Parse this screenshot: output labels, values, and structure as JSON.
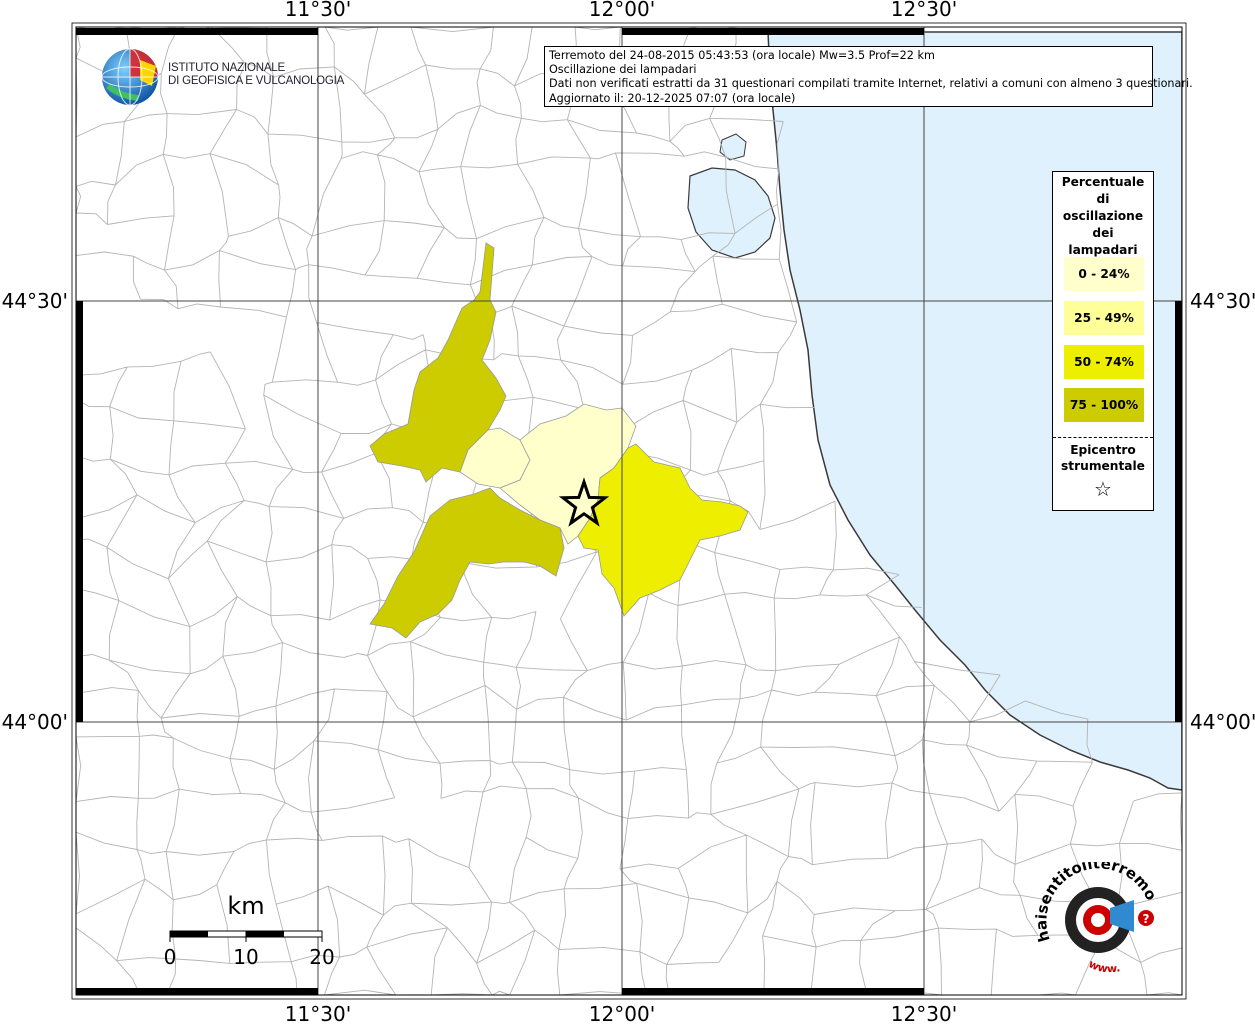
{
  "info_box": {
    "lines": [
      "Terremoto del 24-08-2015 05:43:53 (ora locale) Mw=3.5 Prof=22 km",
      "Oscillazione dei lampadari",
      "Dati non verificati estratti da 31 questionari compilati tramite Internet, relativi a comuni con almeno 3 questionari.",
      "Aggiornato il: 20-12-2025 07:07 (ora locale)"
    ]
  },
  "axes": {
    "lon_labels": [
      "11°30'",
      "12°00'",
      "12°30'"
    ],
    "lat_labels": [
      "44°30'",
      "44°00'"
    ]
  },
  "legend": {
    "title": [
      "Percentuale",
      "di",
      "oscillazione",
      "dei",
      "lampadari"
    ],
    "classes": [
      {
        "label": "0 - 24%",
        "color": "#ffffcc"
      },
      {
        "label": "25 - 49%",
        "color": "#ffff99"
      },
      {
        "label": "50 - 74%",
        "color": "#eeee00"
      },
      {
        "label": "75 - 100%",
        "color": "#cccc00"
      }
    ],
    "epicenter_title": [
      "Epicentro",
      "strumentale"
    ],
    "epicenter_symbol": "☆"
  },
  "scale_bar": {
    "unit": "km",
    "ticks": [
      "0",
      "10",
      "20"
    ]
  },
  "logos": {
    "ingv": [
      "ISTITUTO NAZIONALE",
      "DI GEOFISICA E VULCANOLOGIA"
    ],
    "hst": "haisentitoilterremoto.it",
    "hst_www": "www."
  },
  "colors": {
    "sea": "#dff1fd",
    "border": "#b4b4b4",
    "coast": "#3a3a3a"
  }
}
